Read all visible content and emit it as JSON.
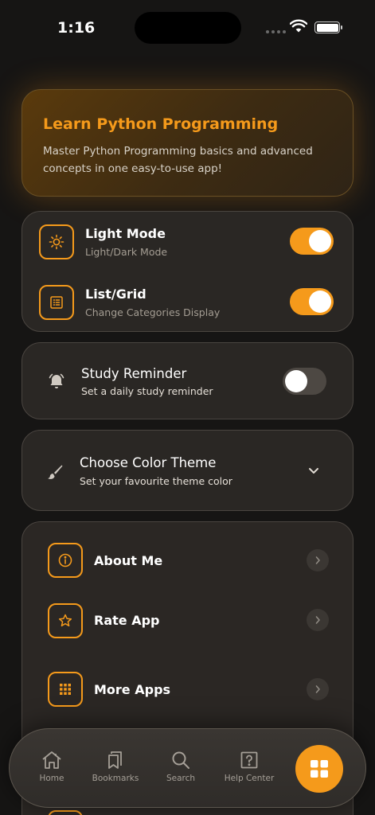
{
  "status": {
    "time": "1:16"
  },
  "hero": {
    "title": "Learn Python Programming",
    "description": "Master Python Programming basics and advanced concepts in one easy-to-use app!"
  },
  "settings": [
    {
      "title": "Light Mode",
      "subtitle": "Light/Dark Mode",
      "icon": "sun-icon",
      "on": true
    },
    {
      "title": "List/Grid",
      "subtitle": "Change Categories Display",
      "icon": "list-icon",
      "on": true
    }
  ],
  "reminder": {
    "title": "Study Reminder",
    "subtitle": "Set a daily study reminder",
    "icon": "bell-icon",
    "on": false
  },
  "theme": {
    "title": "Choose Color Theme",
    "subtitle": "Set your favourite theme color",
    "icon": "brush-icon"
  },
  "links": [
    {
      "title": "About Me",
      "icon": "info-icon"
    },
    {
      "title": "Rate App",
      "icon": "star-icon"
    },
    {
      "title": "More Apps",
      "icon": "apps-grid-icon"
    }
  ],
  "tabbar": {
    "tabs": [
      {
        "label": "Home",
        "icon": "home-icon"
      },
      {
        "label": "Bookmarks",
        "icon": "bookmarks-icon"
      },
      {
        "label": "Search",
        "icon": "search-icon"
      },
      {
        "label": "Help Center",
        "icon": "help-icon"
      }
    ],
    "fab_icon": "grid-icon"
  },
  "colors": {
    "accent": "#f59a1b",
    "background": "#161514",
    "card": "#2a2724"
  }
}
